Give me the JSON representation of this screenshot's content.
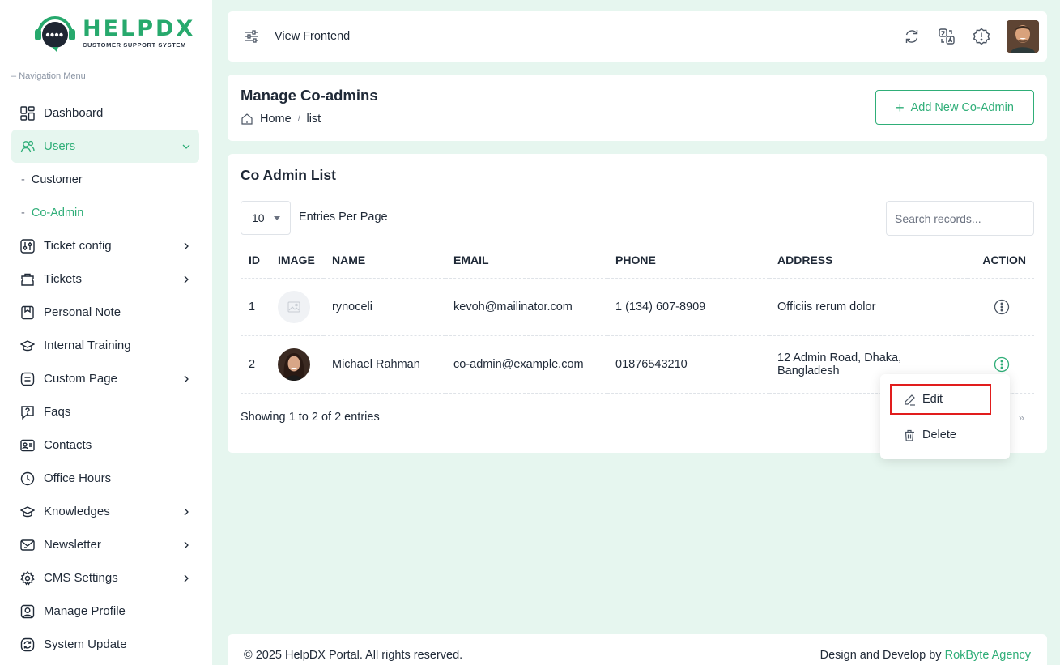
{
  "brand": {
    "name": "HELPDX",
    "tagline": "CUSTOMER SUPPORT SYSTEM",
    "accent": "#2fae78"
  },
  "sidebar": {
    "heading": "Navigation Menu",
    "items": [
      {
        "label": "Dashboard",
        "icon": "dashboard-icon"
      },
      {
        "label": "Users",
        "icon": "users-icon",
        "expanded": true
      },
      {
        "label": "Customer",
        "sub": true
      },
      {
        "label": "Co-Admin",
        "sub": true,
        "active": true
      },
      {
        "label": "Ticket config",
        "icon": "sliders-icon"
      },
      {
        "label": "Tickets",
        "icon": "ticket-icon"
      },
      {
        "label": "Personal Note",
        "icon": "note-icon"
      },
      {
        "label": "Internal Training",
        "icon": "graduation-icon"
      },
      {
        "label": "Custom Page",
        "icon": "page-icon"
      },
      {
        "label": "Faqs",
        "icon": "question-icon"
      },
      {
        "label": "Contacts",
        "icon": "contact-card-icon"
      },
      {
        "label": "Office Hours",
        "icon": "clock-icon"
      },
      {
        "label": "Knowledges",
        "icon": "book-icon"
      },
      {
        "label": "Newsletter",
        "icon": "mail-icon"
      },
      {
        "label": "CMS Settings",
        "icon": "gear-icon"
      },
      {
        "label": "Manage Profile",
        "icon": "profile-icon"
      },
      {
        "label": "System Update",
        "icon": "refresh-icon"
      }
    ]
  },
  "topbar": {
    "view_frontend": "View Frontend"
  },
  "header": {
    "title": "Manage Co-admins",
    "breadcrumb_home": "Home",
    "breadcrumb_current": "list",
    "add_button": "Add New Co-Admin"
  },
  "list": {
    "title": "Co Admin List",
    "per_page_value": "10",
    "per_page_label": "Entries Per Page",
    "search_placeholder": "Search records...",
    "columns": [
      "ID",
      "IMAGE",
      "NAME",
      "EMAIL",
      "PHONE",
      "ADDRESS",
      "ACTION"
    ],
    "rows": [
      {
        "id": "1",
        "name": "rynoceli",
        "email": "kevoh@mailinator.com",
        "phone": "1 (134) 607-8909",
        "address": "Officiis rerum dolor"
      },
      {
        "id": "2",
        "name": "Michael Rahman",
        "email": "co-admin@example.com",
        "phone": "01876543210",
        "address": "12 Admin Road, Dhaka, Bangladesh"
      }
    ],
    "showing": "Showing 1 to 2 of 2 entries",
    "pager_next": "»"
  },
  "dropdown": {
    "edit": "Edit",
    "delete": "Delete"
  },
  "footer": {
    "copyright": "© 2025 HelpDX Portal. All rights reserved.",
    "credit_prefix": "Design and Develop by",
    "credit_brand": "RokByte Agency"
  }
}
